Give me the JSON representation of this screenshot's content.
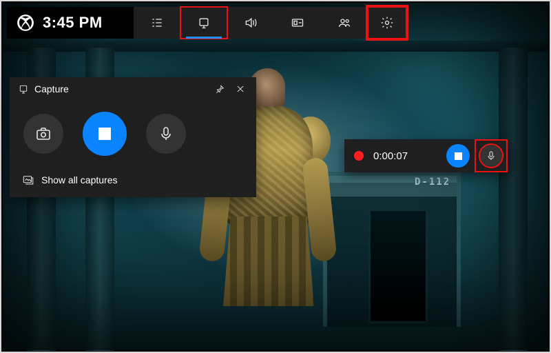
{
  "clock": {
    "time": "3:45 PM"
  },
  "topbar": {
    "icons": [
      "widgets-menu",
      "capture",
      "audio",
      "performance",
      "xbox-social",
      "settings"
    ],
    "active": "capture",
    "highlighted": [
      "capture",
      "settings"
    ]
  },
  "capture_widget": {
    "title": "Capture",
    "buttons": {
      "screenshot": "screenshot",
      "record_stop": "stop",
      "mic": "microphone"
    },
    "footer_label": "Show all captures"
  },
  "recording_status": {
    "indicator": "recording",
    "elapsed": "0:00:07",
    "controls": [
      "stop",
      "microphone"
    ],
    "highlighted": "microphone"
  },
  "background": {
    "door_label": "D-112"
  }
}
